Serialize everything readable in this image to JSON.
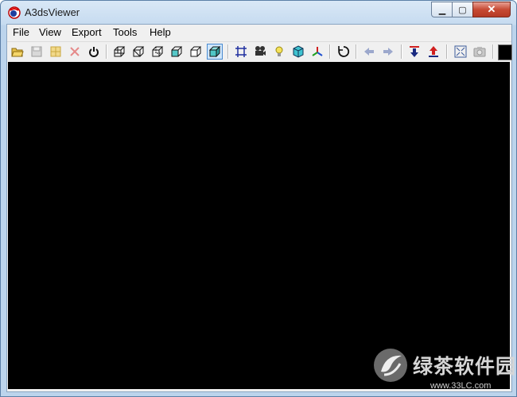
{
  "window": {
    "title": "A3dsViewer"
  },
  "window_controls": {
    "minimize": "▁",
    "maximize": "▢",
    "close": "✕"
  },
  "menu": {
    "items": [
      "File",
      "View",
      "Export",
      "Tools",
      "Help"
    ]
  },
  "toolbar": {
    "icons": [
      "open-folder-icon",
      "save-icon",
      "grid-icon",
      "delete-icon",
      "power-icon",
      "cube-wireframe-1-icon",
      "cube-wireframe-2-icon",
      "cube-wireframe-3-icon",
      "cube-wireframe-4-icon",
      "cube-wireframe-5-icon",
      "cube-solid-icon",
      "frame-icon",
      "camera-reel-icon",
      "light-bulb-icon",
      "cube-cyan-icon",
      "axis-icon",
      "rotate-icon",
      "arrow-left-icon",
      "arrow-right-icon",
      "move-down-icon",
      "move-up-icon",
      "fullscreen-icon",
      "camera-icon"
    ],
    "background_color": "#000000"
  },
  "watermark": {
    "cn": "绿茶软件园",
    "url": "www.33LC.com"
  }
}
